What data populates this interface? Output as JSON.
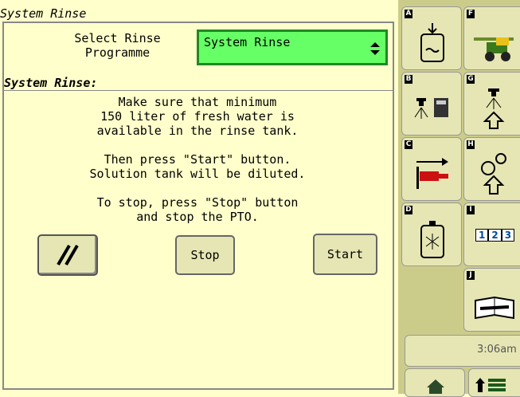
{
  "title": "System Rinse",
  "select": {
    "label": "Select Rinse\nProgramme",
    "value": "System Rinse"
  },
  "section_title": "System Rinse:",
  "instructions": "Make sure that minimum\n150 liter of fresh water is\navailable in the rinse tank.\n\nThen press \"Start\" button.\nSolution tank will be diluted.\n\nTo stop, press \"Stop\" button\nand stop the PTO.",
  "buttons": {
    "stop": "Stop",
    "start": "Start"
  },
  "sidebar": {
    "tiles": [
      {
        "letter": "A",
        "icon": "rinse-tank-icon"
      },
      {
        "letter": "F",
        "icon": "sprayer-machine-icon"
      },
      {
        "letter": "B",
        "icon": "nozzle-calculator-icon"
      },
      {
        "letter": "G",
        "icon": "nozzle-up-arrow-icon"
      },
      {
        "letter": "C",
        "icon": "flow-meter-icon"
      },
      {
        "letter": "H",
        "icon": "gear-up-arrow-icon"
      },
      {
        "letter": "D",
        "icon": "tank-rinse-nozzle-icon"
      },
      {
        "letter": "I",
        "icon": "numbered-sections-icon",
        "text": [
          "1",
          "2",
          "3"
        ]
      },
      {
        "letter": "J",
        "icon": "service-manual-icon"
      }
    ],
    "clock": "3:06am",
    "bottom": [
      "home-icon",
      "up-arrow-grid-icon"
    ]
  },
  "colors": {
    "background": "#ffffcc",
    "select_fill": "#66ff66",
    "sidebar": "#cccc8a",
    "tile": "#e6e6b4"
  }
}
